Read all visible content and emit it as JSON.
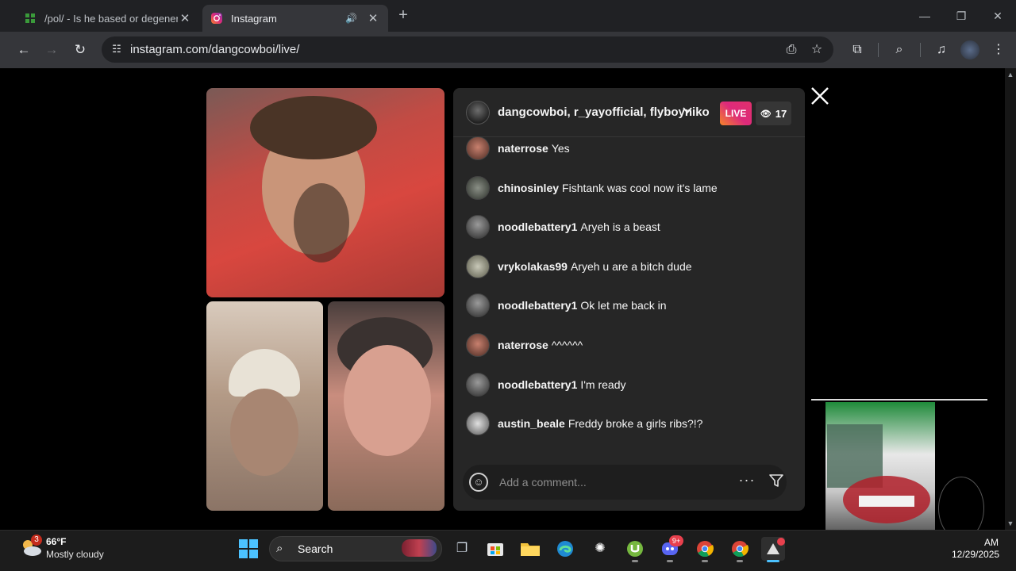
{
  "browser": {
    "tabs": [
      {
        "title": "/pol/ - Is he based or degenerat",
        "icon": "4chan-icon"
      },
      {
        "title": "Instagram",
        "icon": "instagram-icon",
        "audio": true
      }
    ],
    "url": "instagram.com/dangcowboi/live/"
  },
  "live": {
    "participants": "dangcowboi, r_yayofficial, flyboyniko",
    "badge": "LIVE",
    "viewer_count": "17",
    "comments": [
      {
        "user": "naterrose",
        "text": "Yes"
      },
      {
        "user": "chinosinley",
        "text": "Fishtank was cool now it's lame"
      },
      {
        "user": "noodlebattery1",
        "text": "Aryeh is a beast"
      },
      {
        "user": "vrykolakas99",
        "text": "Aryeh u are a bitch dude"
      },
      {
        "user": "noodlebattery1",
        "text": "Ok let me back in"
      },
      {
        "user": "naterrose",
        "text": "^^^^^^"
      },
      {
        "user": "noodlebattery1",
        "text": "I'm ready"
      },
      {
        "user": "austin_beale",
        "text": "Freddy broke a girls ribs?!?"
      }
    ],
    "comment_placeholder": "Add a comment..."
  },
  "taskbar": {
    "weather": {
      "temp": "66°F",
      "desc": "Mostly cloudy",
      "badge": "3"
    },
    "search_label": "Search",
    "discord_badge": "9+",
    "time": "AM",
    "date": "12/29/2025"
  },
  "colors": {
    "live_gradient": [
      "#f58529",
      "#dd2a7b"
    ],
    "panel_bg": "#262626",
    "chrome_bg": "#202124"
  }
}
